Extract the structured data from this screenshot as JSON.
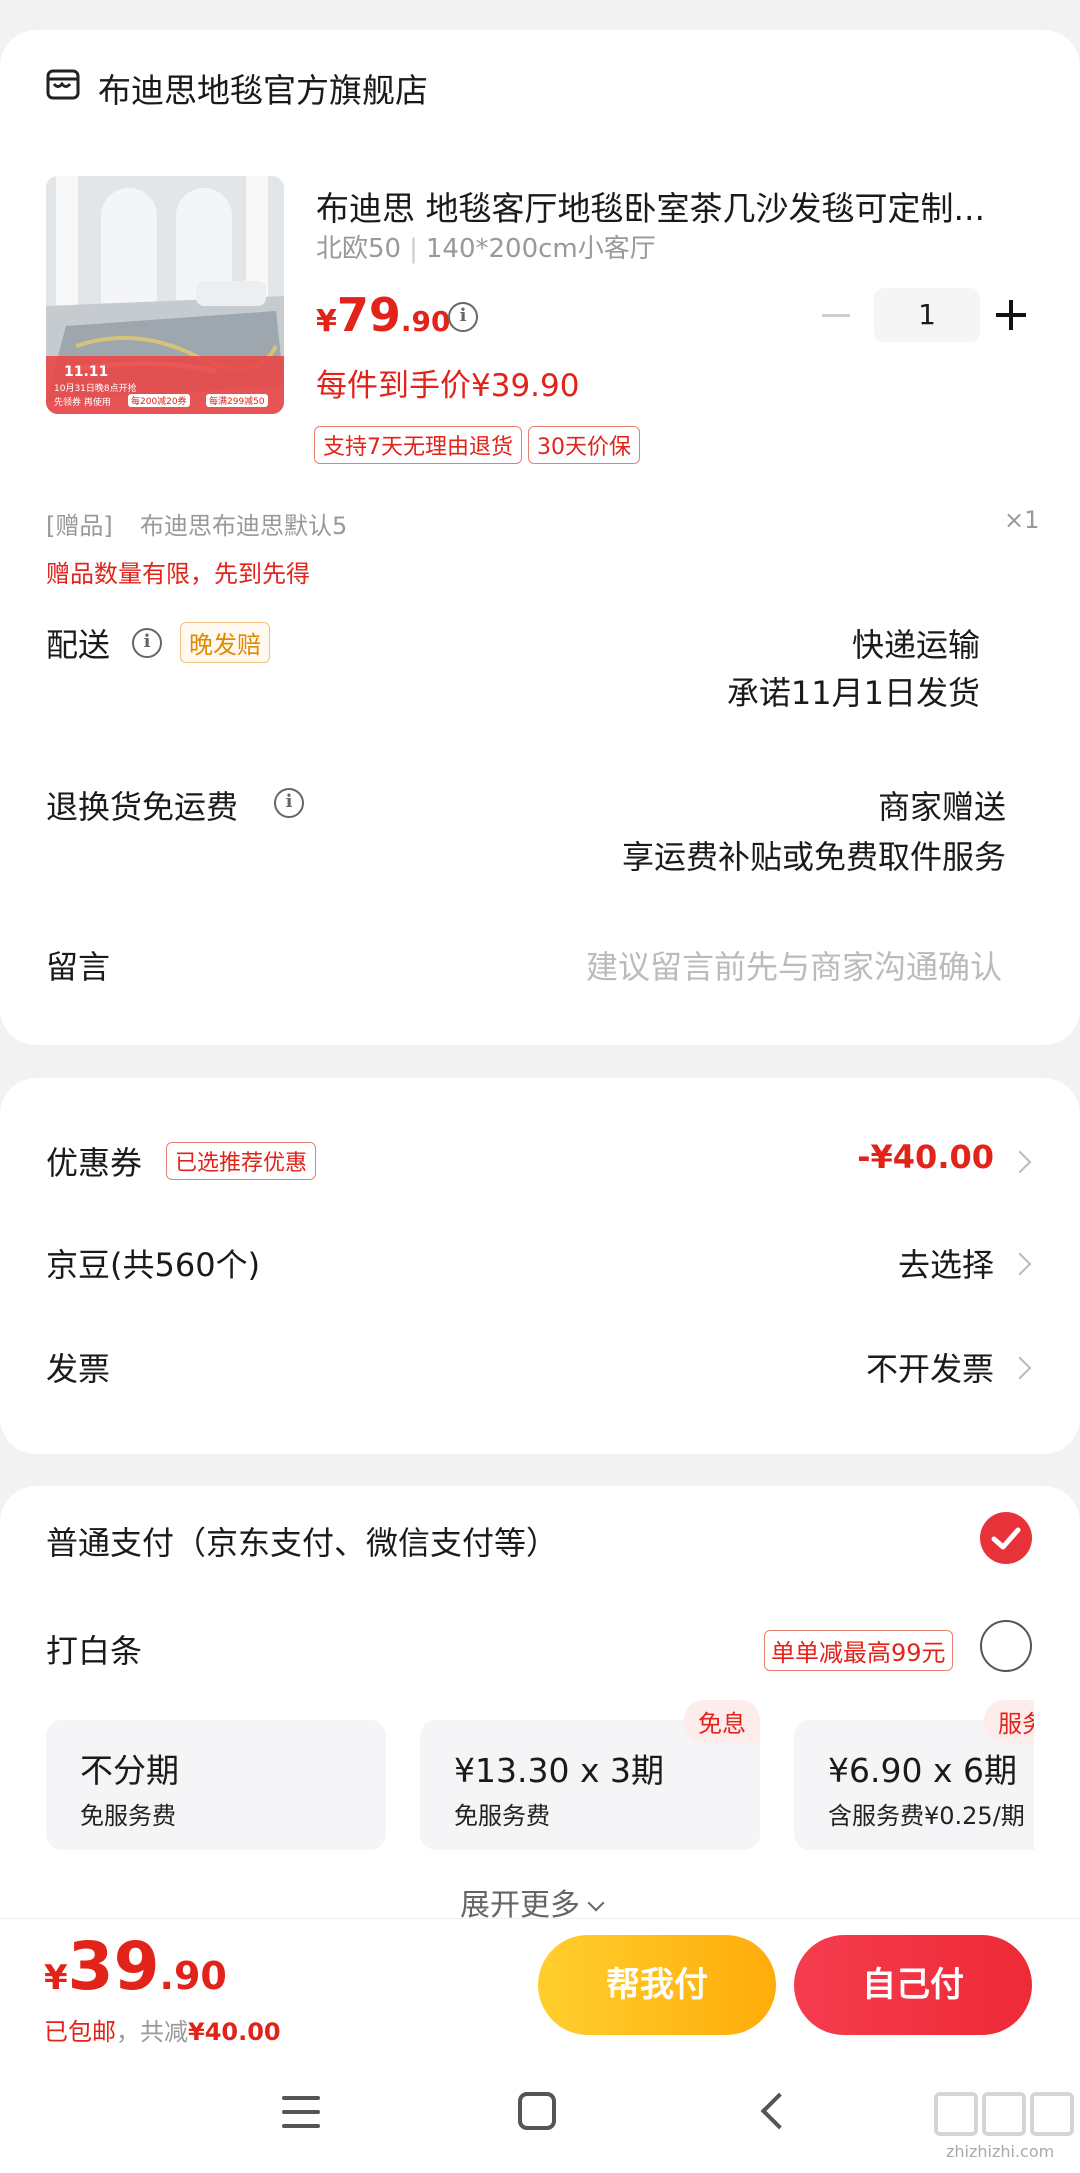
{
  "shop": {
    "name": "布迪思地毯官方旗舰店"
  },
  "product": {
    "title": "布迪思 地毯客厅地毯卧室茶几沙发毯可定制...",
    "spec_color": "北欧50",
    "spec_size": "140*200cm小客厅",
    "price_symbol": "¥",
    "price_int": "79",
    "price_dec": ".90",
    "per_item_price": "每件到手价¥39.90",
    "quantity": "1",
    "tags": [
      "支持7天无理由退货",
      "30天价保"
    ],
    "image_banner_text": [
      "11.11",
      "10月31日晚8点开抢",
      "先领券 再使用",
      "每200减20券",
      "每满299减50"
    ]
  },
  "gift": {
    "label": "[赠品]",
    "name": "布迪思布迪思默认5",
    "qty": "×1",
    "note": "赠品数量有限，先到先得"
  },
  "delivery": {
    "label": "配送",
    "badge": "晚发赔",
    "method": "快递运输",
    "promise": "承诺11月1日发货"
  },
  "returns": {
    "label": "退换货免运费",
    "value": "商家赠送",
    "detail": "享运费补贴或免费取件服务"
  },
  "message": {
    "label": "留言",
    "placeholder": "建议留言前先与商家沟通确认"
  },
  "coupon": {
    "label": "优惠券",
    "badge": "已选推荐优惠",
    "value": "-¥40.00"
  },
  "jingdou": {
    "label": "京豆(共560个)",
    "value": "去选择"
  },
  "invoice": {
    "label": "发票",
    "value": "不开发票"
  },
  "payment": {
    "normal_label": "普通支付（京东支付、微信支付等）",
    "baitiao_label": "打白条",
    "baitiao_promo": "单单减最高99元",
    "plans": [
      {
        "title": "不分期",
        "sub": "免服务费",
        "badge": ""
      },
      {
        "title": "¥13.30 x 3期",
        "sub": "免服务费",
        "badge": "免息"
      },
      {
        "title": "¥6.90 x 6期",
        "sub": "含服务费¥0.25/期",
        "badge": "服务"
      }
    ],
    "expand": "展开更多"
  },
  "footer": {
    "price_symbol": "¥",
    "price_int": "39",
    "price_dec": ".90",
    "shipping": "已包邮",
    "saving_label": "，共减",
    "saving_value": "¥40.00",
    "help_pay": "帮我付",
    "self_pay": "自己付"
  },
  "watermark": {
    "text": "zhizhizhi.com"
  },
  "colors": {
    "accent": "#e2231a",
    "help_btn": "#ffbe1a",
    "pay_btn": "#f0333f"
  }
}
